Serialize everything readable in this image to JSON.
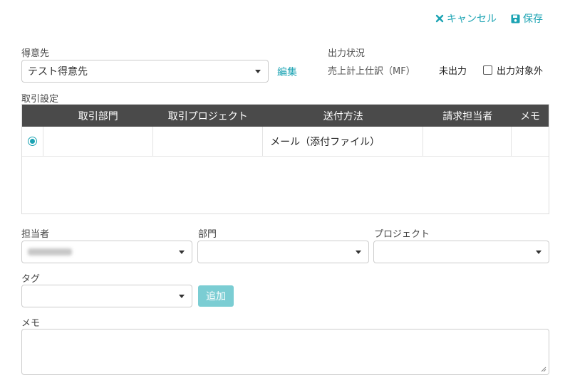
{
  "toolbar": {
    "cancel_label": "キャンセル",
    "save_label": "保存"
  },
  "customer": {
    "label": "得意先",
    "value": "テスト得意先",
    "edit_label": "編集"
  },
  "output_status": {
    "label": "出力状況",
    "item_label": "売上計上仕訳（MF）",
    "item_value": "未出力",
    "exclude_label": "出力対象外"
  },
  "transaction": {
    "label": "取引設定",
    "columns": [
      "取引部門",
      "取引プロジェクト",
      "送付方法",
      "請求担当者",
      "メモ"
    ],
    "rows": [
      {
        "department": "",
        "project": "",
        "delivery": "メール（添付ファイル）",
        "owner": "",
        "memo": ""
      }
    ]
  },
  "fields": {
    "person_label": "担当者",
    "department_label": "部門",
    "project_label": "プロジェクト",
    "tag_label": "タグ",
    "add_label": "追加",
    "memo_label": "メモ"
  },
  "colors": {
    "accent": "#1ba3b3",
    "header_bg": "#4a4a4a",
    "add_button": "#7bcdd3"
  }
}
